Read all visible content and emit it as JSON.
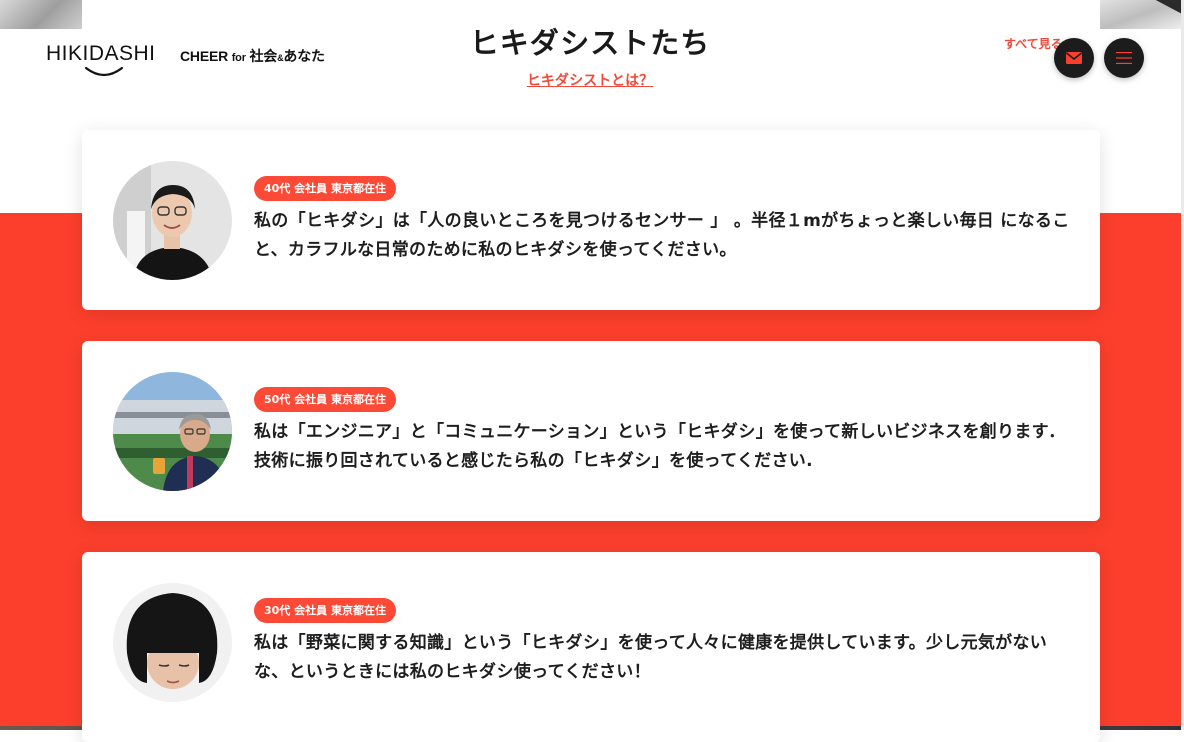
{
  "header": {
    "logo_text": "HIKIDASHI",
    "tagline_main": "CHEER",
    "tagline_for": "for",
    "tagline_society": "社会",
    "tagline_amp": "&",
    "tagline_you": "あなた"
  },
  "section": {
    "title": "ヒキダシストたち",
    "about_link": "ヒキダシストとは？",
    "see_all": "すべて見る"
  },
  "actions": {
    "mail_icon": "envelope-icon",
    "menu_icon": "hamburger-menu-icon"
  },
  "colors": {
    "accent": "#fc3f2c",
    "badge": "#fc4a37",
    "link": "#f2493a",
    "button": "#1c1c1c"
  },
  "profiles": [
    {
      "badge": "40代 会社員 東京都在住",
      "quote": "私の「ヒキダシ」は「人の良いところを見つけるセンサー 」 。半径１mがちょっと楽しい毎日 になること、カラフルな日常のために私のヒキダシを使ってください。"
    },
    {
      "badge": "50代 会社員 東京都在住",
      "quote": "私は「エンジニア」と「コミュニケーション」という「ヒキダシ」を使って新しいビジネスを創ります．技術に振り回されていると感じたら私の「ヒキダシ」を使ってください."
    },
    {
      "badge": "30代 会社員 東京都在住",
      "quote": "私は「野菜に関する知識」という「ヒキダシ」を使って人々に健康を提供しています。少し元気がないな、というときには私のヒキダシ使ってください！"
    }
  ]
}
